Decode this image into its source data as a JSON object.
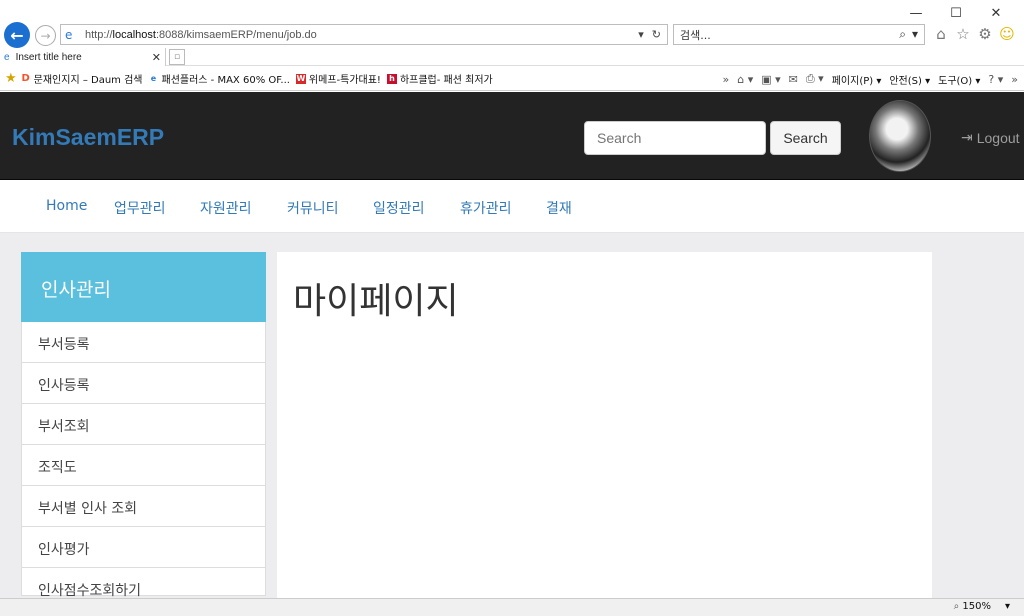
{
  "browser": {
    "window_controls": {
      "minimize": "—",
      "maximize": "☐",
      "close": "✕"
    },
    "address": {
      "url_prefix": "http://",
      "url_host": "localhost",
      "url_rest": ":8088/kimsaemERP/menu/job.do"
    },
    "search_placeholder": "검색...",
    "tab": {
      "title": "Insert title here"
    },
    "favorites": [
      {
        "icon": "D",
        "label": "문재인지지 – Daum 검색"
      },
      {
        "icon": "e",
        "label": "패션플러스 - MAX 60% OF..."
      },
      {
        "icon": "W",
        "label": "위메프-특가대표!"
      },
      {
        "icon": "h",
        "label": "하프클럽- 패션 최저가"
      }
    ],
    "command_bar": {
      "page": "페이지(P)",
      "safety": "안전(S)",
      "tools": "도구(O)"
    },
    "zoom": "150%"
  },
  "header": {
    "brand": "KimSaemERP",
    "search_placeholder": "Search",
    "search_button": "Search",
    "logout": "Logout"
  },
  "menu": {
    "items": [
      "Home",
      "업무관리",
      "자원관리",
      "커뮤니티",
      "일정관리",
      "휴가관리",
      "결재"
    ]
  },
  "sidebar": {
    "title": "인사관리",
    "items": [
      "부서등록",
      "인사등록",
      "부서조회",
      "조직도",
      "부서별 인사 조회",
      "인사평가",
      "인사점수조회하기"
    ]
  },
  "main": {
    "title": "마이페이지"
  }
}
